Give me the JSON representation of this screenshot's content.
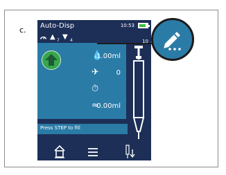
{
  "figure": {
    "panel_label": "c."
  },
  "device": {
    "app_title": "Auto-Disp",
    "clock": "10:53",
    "status": {
      "left_value": "7",
      "right_value": "4"
    },
    "scale_label": {
      "value": "10",
      "unit": "ml"
    },
    "rows": [
      {
        "icon": "droplet-icon",
        "value": "1.00ml"
      },
      {
        "icon": "speed-icon",
        "value": "0"
      },
      {
        "icon": "stopwatch-icon",
        "value": ""
      },
      {
        "icon": "wave-icon",
        "value": "0.00ml"
      }
    ],
    "message": "Press STEP to fill",
    "nav": [
      "home-icon",
      "menu-icon",
      "dispense-mode-icon"
    ]
  },
  "zoom": {
    "icon": "edit-pencil-icon"
  },
  "colors": {
    "screen_dark": "#1d2f57",
    "screen_blue": "#2b7ba7",
    "accent_green": "#37a64b",
    "battery_green": "#3fbb3f"
  }
}
